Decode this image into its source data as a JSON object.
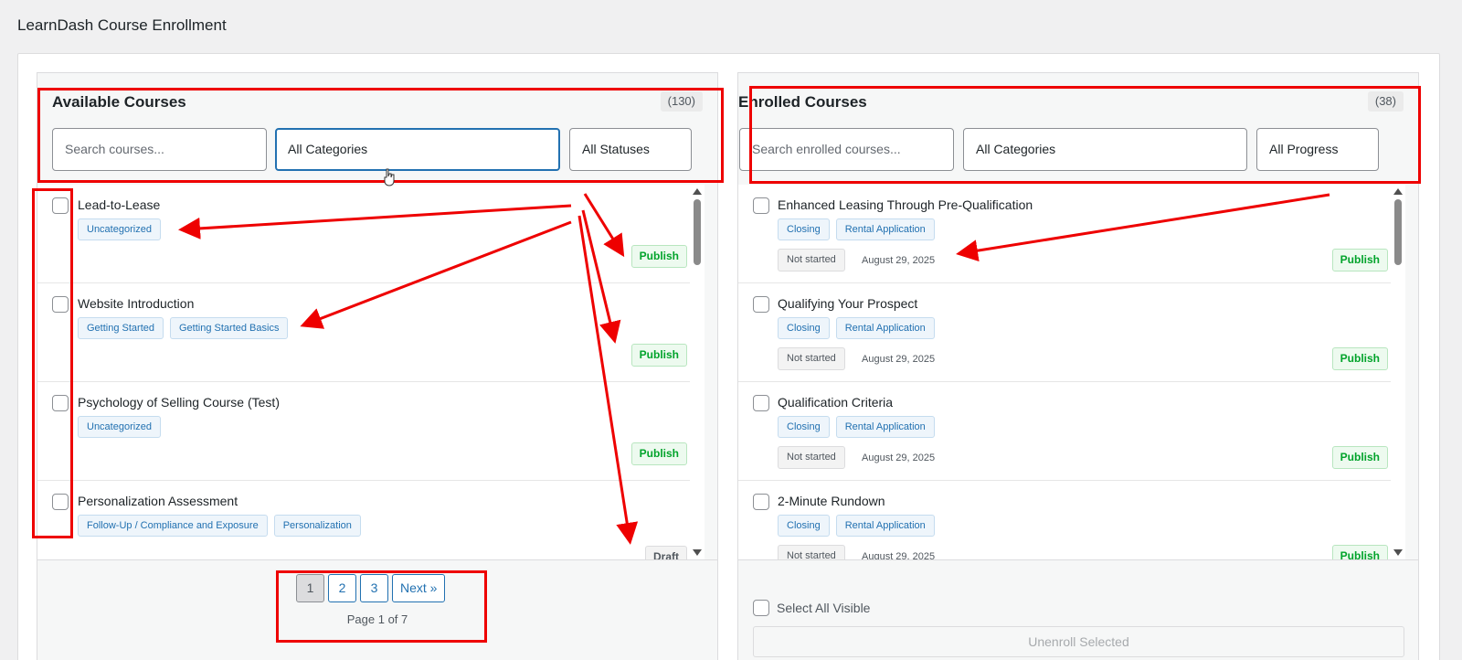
{
  "page_title": "LearnDash Course Enrollment",
  "available": {
    "title": "Available Courses",
    "count": "(130)",
    "search_placeholder": "Search courses...",
    "category_value": "All Categories",
    "status_value": "All Statuses",
    "courses": [
      {
        "title": "Lead-to-Lease",
        "tags": [
          "Uncategorized"
        ],
        "status": "Publish"
      },
      {
        "title": "Website Introduction",
        "tags": [
          "Getting Started",
          "Getting Started Basics"
        ],
        "status": "Publish"
      },
      {
        "title": "Psychology of Selling Course (Test)",
        "tags": [
          "Uncategorized"
        ],
        "status": "Publish"
      },
      {
        "title": "Personalization Assessment",
        "tags": [
          "Follow-Up / Compliance and Exposure",
          "Personalization"
        ],
        "status": "Draft"
      }
    ],
    "pagination": {
      "pages": [
        "1",
        "2",
        "3"
      ],
      "next": "Next »",
      "info": "Page 1 of 7"
    }
  },
  "enrolled": {
    "title": "Enrolled Courses",
    "count": "(38)",
    "search_placeholder": "Search enrolled courses...",
    "category_value": "All Categories",
    "progress_value": "All Progress",
    "courses": [
      {
        "title": "Enhanced Leasing Through Pre-Qualification",
        "tags": [
          "Closing",
          "Rental Application"
        ],
        "progress": "Not started",
        "date": "August 29, 2025",
        "status": "Publish"
      },
      {
        "title": "Qualifying Your Prospect",
        "tags": [
          "Closing",
          "Rental Application"
        ],
        "progress": "Not started",
        "date": "August 29, 2025",
        "status": "Publish"
      },
      {
        "title": "Qualification Criteria",
        "tags": [
          "Closing",
          "Rental Application"
        ],
        "progress": "Not started",
        "date": "August 29, 2025",
        "status": "Publish"
      },
      {
        "title": "2-Minute Rundown",
        "tags": [
          "Closing",
          "Rental Application"
        ],
        "progress": "Not started",
        "date": "August 29, 2025",
        "status": "Publish"
      }
    ],
    "select_all_label": "Select All Visible",
    "unenroll_label": "Unenroll Selected"
  },
  "colors": {
    "annotation": "#ee0000",
    "accent": "#2271b1",
    "publish": "#00a32a"
  }
}
